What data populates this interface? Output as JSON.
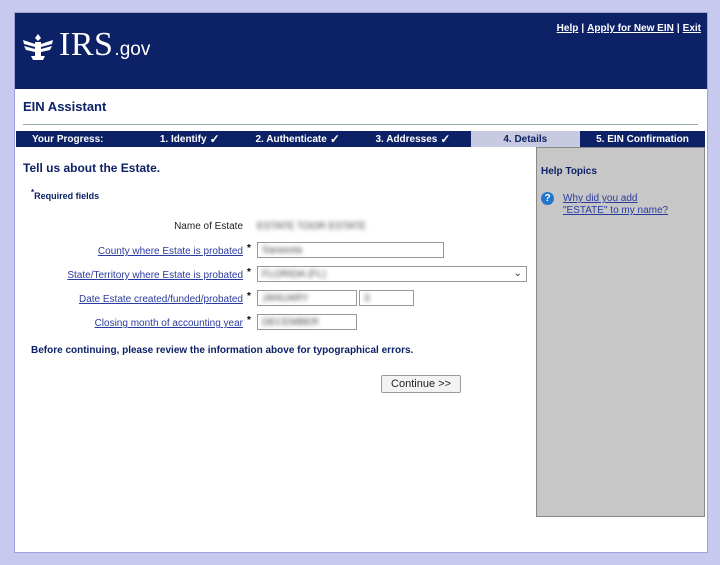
{
  "header": {
    "logo_text": "IRS",
    "logo_suffix": ".gov",
    "links": {
      "help": "Help",
      "apply": "Apply for New EIN",
      "exit": "Exit",
      "separator": "|"
    }
  },
  "app_title": "EIN Assistant",
  "progress": {
    "label": "Your Progress:",
    "steps": [
      {
        "label": "1. Identify",
        "mark": "✓"
      },
      {
        "label": "2. Authenticate",
        "mark": "✓"
      },
      {
        "label": "3. Addresses",
        "mark": "✓"
      },
      {
        "label": "4. Details",
        "mark": ""
      },
      {
        "label": "5. EIN Confirmation",
        "mark": ""
      }
    ]
  },
  "form": {
    "title": "Tell us about the Estate.",
    "required_note": "Required fields",
    "required_marker": "*",
    "name_label": "Name of Estate",
    "name_value": "ESTATE TOOR ESTATE",
    "county_label": "County where Estate is probated",
    "county_value": "Sarasota",
    "state_label": "State/Territory where Estate is probated",
    "state_value": "FLORIDA (FL)",
    "date_label": "Date Estate created/funded/probated",
    "date_month": "JANUARY",
    "date_day": "3",
    "closing_label": "Closing month of accounting year",
    "closing_value": "DECEMBER",
    "review_note": "Before continuing, please review the information above for typographical errors.",
    "continue_label": "Continue >>"
  },
  "help": {
    "title": "Help Topics",
    "link": "Why did you add \"ESTATE\" to my name?"
  },
  "colors": {
    "navy": "#0d2167",
    "link": "#2a3b9e",
    "active_step": "#c7cae0",
    "sidebar": "#c7c7c7"
  }
}
